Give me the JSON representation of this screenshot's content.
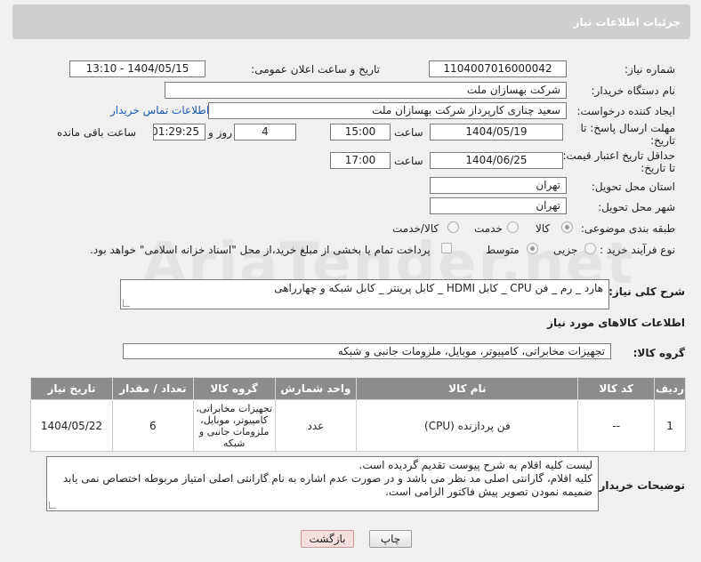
{
  "header": {
    "title": "جزئیات اطلاعات نیاز"
  },
  "fields": {
    "need_number_label": "شماره نیاز:",
    "need_number": "1104007016000042",
    "announce_label": "تاریخ و ساعت اعلان عمومی:",
    "announce_value": "1404/05/15 - 13:10",
    "buyer_org_label": "نام دستگاه خریدار:",
    "buyer_org": "شرکت بهسازان ملت",
    "creator_label": "ایجاد کننده درخواست:",
    "creator": "سعید چناری کارپرداز شرکت بهسازان ملت",
    "contact_link": "اطلاعات تماس خریدار",
    "deadline_label_1": "مهلت ارسال پاسخ: تا",
    "deadline_label_2": "تاریخ:",
    "deadline_date": "1404/05/19",
    "time_label": "ساعت",
    "deadline_time": "15:00",
    "days_value": "4",
    "days_label": "روز و",
    "remaining_time": "01:29:25",
    "remaining_label": "ساعت باقی مانده",
    "price_label_1": "حداقل تاریخ اعتبار قیمت:",
    "price_label_2": "تا تاریخ:",
    "price_date": "1404/06/25",
    "price_time": "17:00",
    "province_label": "استان محل تحویل:",
    "province": "تهران",
    "city_label": "شهر محل تحویل:",
    "city": "تهران",
    "category_label": "طبقه بندی موضوعی:",
    "category_options": [
      "کالا",
      "خدمت",
      "کالا/خدمت"
    ],
    "process_label": "نوع فرآیند خرید :",
    "process_options": [
      "جزیی",
      "متوسط"
    ],
    "payment_note": "پرداخت تمام یا بخشی از مبلغ خرید،از محل \"اسناد خزانه اسلامی\" خواهد بود."
  },
  "description": {
    "label": "شرح کلی نیاز:",
    "text": "هارد _ رم _ فن CPU _ کابل HDMI _ کابل پرینتر _ کابل شبکه و چهارراهی"
  },
  "goods_info": {
    "title": "اطلاعات کالاهای مورد نیاز",
    "group_label": "گروه کالا:",
    "group_value": "تجهیزات مخابراتی، کامپیوتر، موبایل، ملزومات جانبی و شبکه"
  },
  "table": {
    "headers": [
      "ردیف",
      "کد کالا",
      "نام کالا",
      "واحد شمارش",
      "گروه کالا",
      "تعداد / مقدار",
      "تاریخ نیاز"
    ],
    "rows": [
      {
        "row": "1",
        "code": "--",
        "name": "فن پردازنده (CPU)",
        "unit": "عدد",
        "group": "تجهیزات مخابراتی، کامپیوتر، موبایل، ملزومات جانبی و شبکه",
        "qty": "6",
        "date": "1404/05/22"
      }
    ]
  },
  "buyer_notes": {
    "label": "توضیحات خریدار:",
    "line1": "لیست کلیه اقلام به شرح پیوست تقدیم گردیده است.",
    "line2": "کلیه اقلام، گارانتی اصلی مد نظر می باشد و در صورت عدم اشاره به نام گارانتی اصلی امتیاز مربوطه اختصاص نمی یابد",
    "line3": "ضمیمه نمودن تصویر پیش فاکتور الزامی است."
  },
  "buttons": {
    "print": "چاپ",
    "back": "بازگشت"
  },
  "watermark": "AriaTender.net"
}
